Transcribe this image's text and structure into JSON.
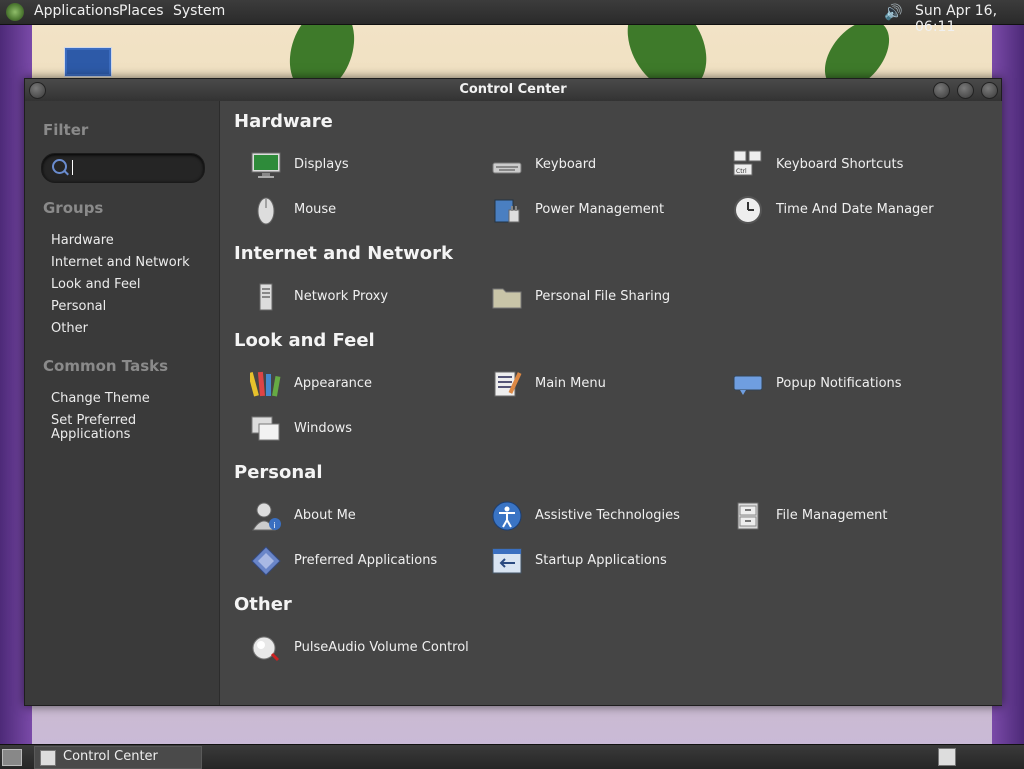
{
  "top_panel": {
    "menus": [
      "Applications",
      "Places",
      "System"
    ],
    "clock": "Sun Apr 16, 06:11"
  },
  "window": {
    "title": "Control Center"
  },
  "sidebar": {
    "filter_heading": "Filter",
    "search_value": "",
    "groups_heading": "Groups",
    "groups": [
      "Hardware",
      "Internet and Network",
      "Look and Feel",
      "Personal",
      "Other"
    ],
    "tasks_heading": "Common Tasks",
    "tasks": [
      "Change Theme",
      "Set Preferred\nApplications"
    ]
  },
  "sections": {
    "hardware": {
      "title": "Hardware",
      "items": [
        "Displays",
        "Keyboard",
        "Keyboard Shortcuts",
        "Mouse",
        "Power Management",
        "Time And Date Manager"
      ]
    },
    "internet": {
      "title": "Internet and Network",
      "items": [
        "Network Proxy",
        "Personal File Sharing"
      ]
    },
    "look": {
      "title": "Look and Feel",
      "items": [
        "Appearance",
        "Main Menu",
        "Popup Notifications",
        "Windows"
      ]
    },
    "personal": {
      "title": "Personal",
      "items": [
        "About Me",
        "Assistive Technologies",
        "File Management",
        "Preferred Applications",
        "Startup Applications"
      ]
    },
    "other": {
      "title": "Other",
      "items": [
        "PulseAudio Volume Control"
      ]
    }
  },
  "bottom_panel": {
    "task_label": "Control Center"
  },
  "colors": {
    "panel": "#2a2a2a",
    "window_bg": "#454545",
    "sidebar_bg": "#3a3a3a",
    "heading_dim": "#8a8a8a"
  }
}
